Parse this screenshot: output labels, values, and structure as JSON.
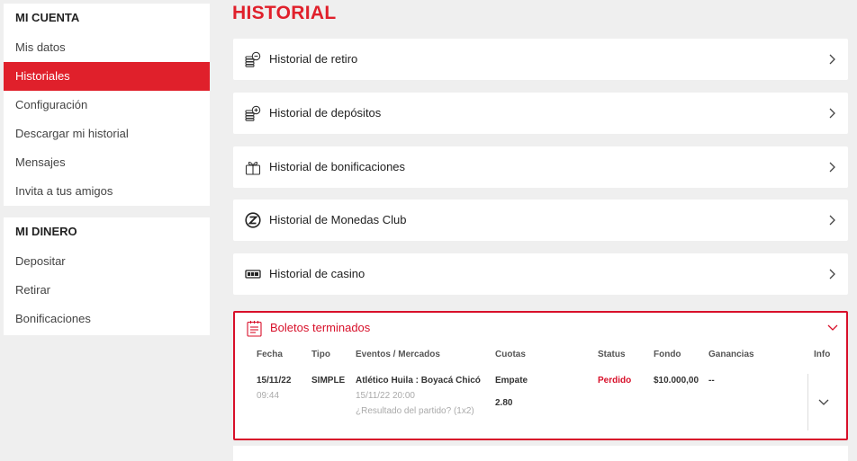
{
  "sidebar": {
    "account": {
      "header": "MI CUENTA",
      "items": [
        {
          "label": "Mis datos"
        },
        {
          "label": "Historiales"
        },
        {
          "label": "Configuración"
        },
        {
          "label": "Descargar mi historial"
        },
        {
          "label": "Mensajes"
        },
        {
          "label": "Invita a tus amigos"
        }
      ]
    },
    "money": {
      "header": "MI DINERO",
      "items": [
        {
          "label": "Depositar"
        },
        {
          "label": "Retirar"
        },
        {
          "label": "Bonificaciones"
        }
      ]
    }
  },
  "main": {
    "title": "HISTORIAL",
    "cards": [
      {
        "label": "Historial de retiro",
        "icon": "coins-minus-icon"
      },
      {
        "label": "Historial de depósitos",
        "icon": "coins-plus-icon"
      },
      {
        "label": "Historial de bonificaciones",
        "icon": "gift-icon"
      },
      {
        "label": "Historial de Monedas Club",
        "icon": "z-coin-icon"
      },
      {
        "label": "Historial de casino",
        "icon": "casino-icon"
      }
    ],
    "tickets": {
      "label": "Boletos terminados",
      "columns": {
        "fecha": "Fecha",
        "tipo": "Tipo",
        "eventos": "Eventos / Mercados",
        "cuotas": "Cuotas",
        "status": "Status",
        "fondo": "Fondo",
        "ganancias": "Ganancias",
        "info": "Info"
      },
      "row": {
        "date": "15/11/22",
        "time": "09:44",
        "type": "SIMPLE",
        "event": "Atlético Huila : Boyacá Chicó",
        "event_datetime": "15/11/22 20:00",
        "market": "¿Resultado del partido? (1x2)",
        "selection": "Empate",
        "odds": "2.80",
        "status": "Perdido",
        "stake": "$10.000,00",
        "winnings": "--"
      }
    }
  },
  "colors": {
    "accent": "#e0202b",
    "background": "#efefef"
  }
}
